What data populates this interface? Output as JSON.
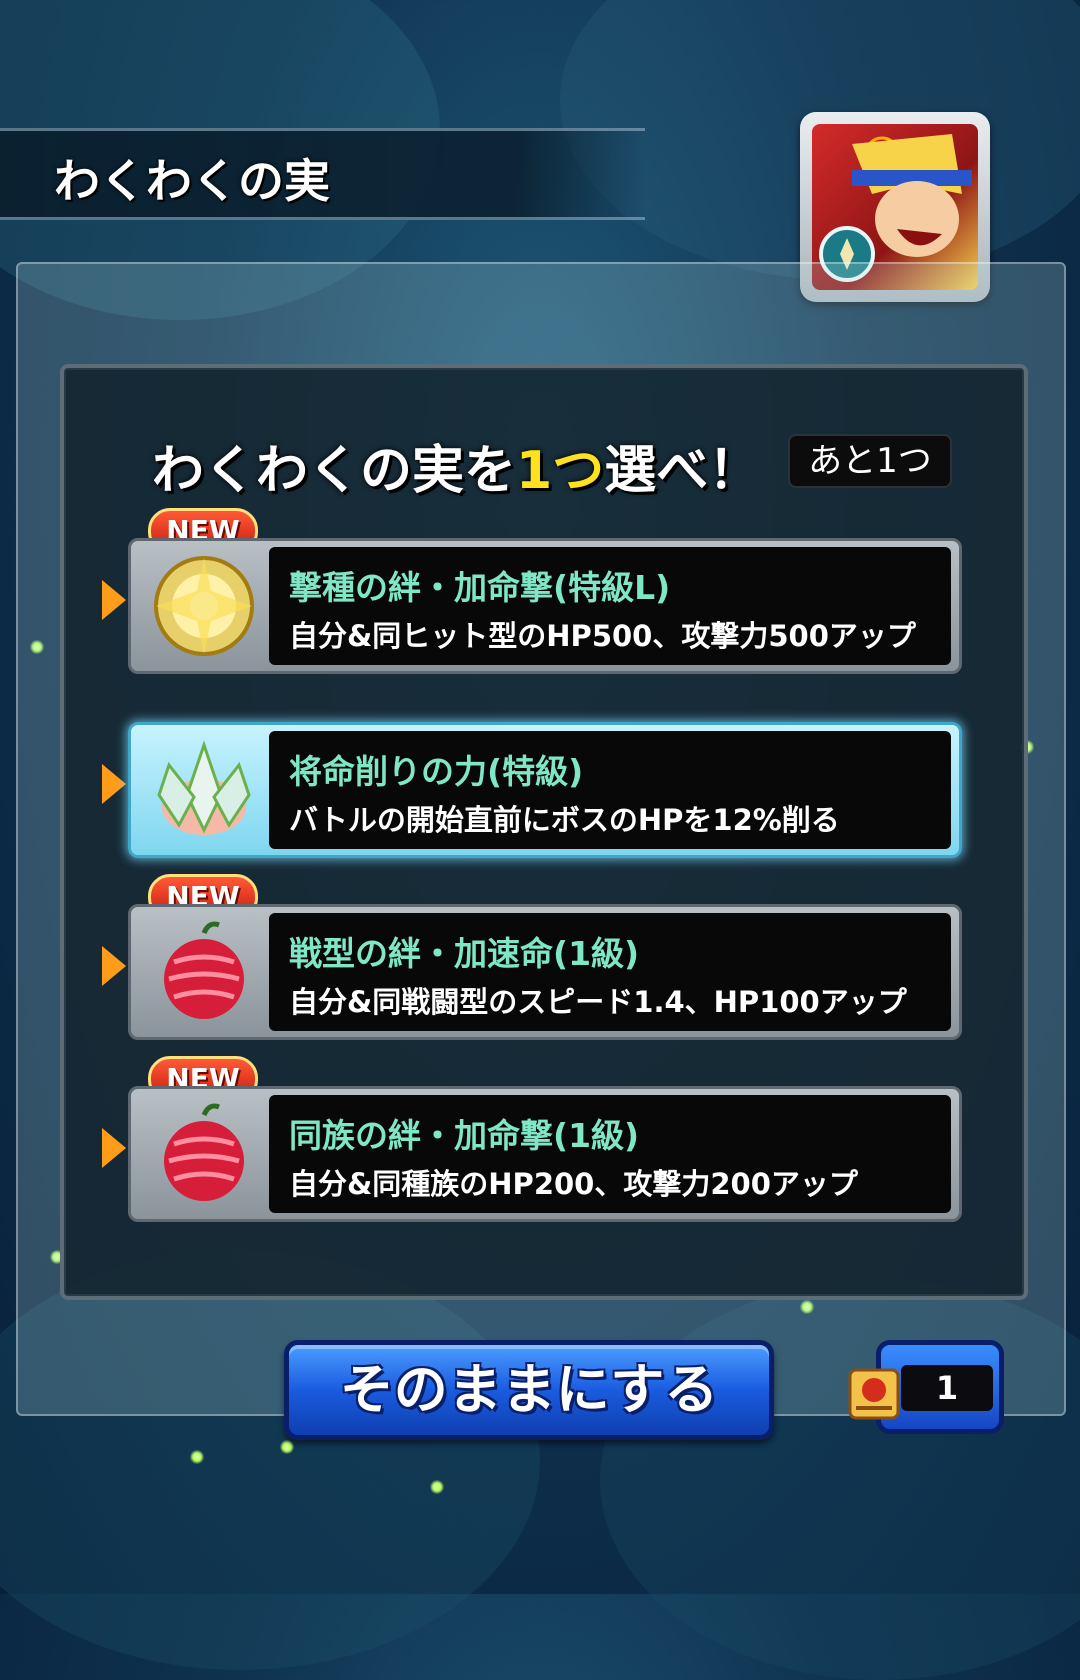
{
  "header": {
    "title": "わくわくの実"
  },
  "character": {
    "icon": "character-portrait-icon",
    "badge_icon": "lotus-badge-icon"
  },
  "selection": {
    "headline_prefix": "わくわくの実を",
    "headline_highlight": "1つ",
    "headline_suffix": "選べ！",
    "remaining": "あと1つ"
  },
  "options": [
    {
      "badge": "NEW",
      "title": "撃種の絆・加命撃(特級L)",
      "desc": "自分&同ヒット型のHP500、攻撃力500アップ",
      "icon": "golden-fruit-icon",
      "selected": false
    },
    {
      "badge": "",
      "title": "将命削りの力(特級)",
      "desc": "バトルの開始直前にボスのHPを12%削る",
      "icon": "lotus-fruit-icon",
      "selected": true
    },
    {
      "badge": "NEW",
      "title": "戦型の絆・加速命(1級)",
      "desc": "自分&同戦闘型のスピード1.4、HP100アップ",
      "icon": "red-fruit-icon",
      "selected": false
    },
    {
      "badge": "NEW",
      "title": "同族の絆・加命撃(1級)",
      "desc": "自分&同種族のHP200、攻撃力200アップ",
      "icon": "red-fruit-icon",
      "selected": false
    }
  ],
  "footer": {
    "keep_label": "そのままにする",
    "ticket_icon": "scroll-ticket-icon",
    "ticket_count": "1"
  },
  "colors": {
    "accent": "#ffe21e",
    "option_title": "#7fe6c6",
    "button": "#1a5ce0",
    "badge": "#e0301a"
  }
}
